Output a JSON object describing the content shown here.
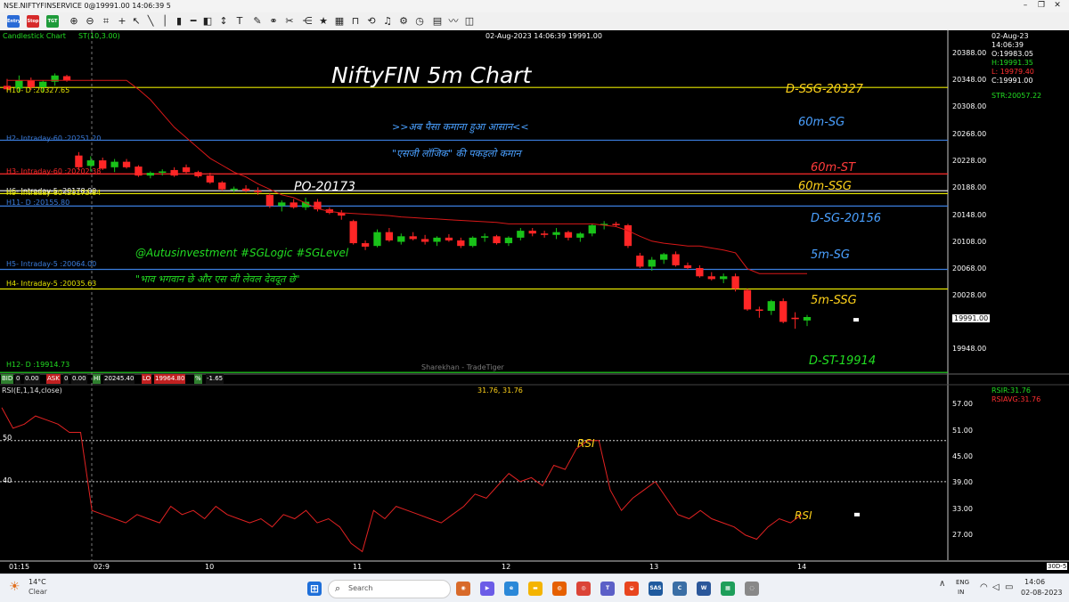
{
  "window": {
    "title": "NSE.NIFTYFINSERVICE 0@19991.00 14:06:39 5"
  },
  "toolbar": {
    "entry_label": "Entry",
    "stop_label": "Stop",
    "tgt_label": "TGT"
  },
  "chart": {
    "type_label": "Candlestick Chart",
    "indicator_label": "ST(10,3.00)",
    "header_center": "02-Aug-2023 14:06:39 19991.00",
    "title": "NiftyFIN 5m Chart",
    "watermark": "Sharekhan - TradeTiger",
    "price_box": "19991.00",
    "info": {
      "date": "02-Aug-23",
      "time": "14:06:39",
      "open": "O:19983.05",
      "high": "H:19991.35",
      "low": "L: 19979.40",
      "close": "C:19991.00",
      "str": "STR:20057.22"
    },
    "price_ticks": [
      "20388.00",
      "20348.00",
      "20308.00",
      "20268.00",
      "20228.00",
      "20188.00",
      "20148.00",
      "20108.00",
      "20068.00",
      "20028.00",
      "19948.00"
    ],
    "levels": [
      {
        "label": "H10- D :20327.65",
        "color": "#e6e600"
      },
      {
        "label": "H2- Intraday-60 :20251.20",
        "color": "#3b7ddd"
      },
      {
        "label": "H3- Intraday-60 :20202.38",
        "color": "#ff2b2b"
      },
      {
        "label": "H6- Intraday-5 :20178.00",
        "color": "#ffffff"
      },
      {
        "label": "H9- Intraday-60 :20173.84",
        "color": "#e6e600"
      },
      {
        "label": "H11- D :20155.80",
        "color": "#3b7ddd"
      },
      {
        "label": "H5- Intraday-5 :20064.00",
        "color": "#3b7ddd"
      },
      {
        "label": "H4- Intraday-5 :20035.63",
        "color": "#e6e600"
      },
      {
        "label": "H12- D :19914.73",
        "color": "#22dd22"
      }
    ],
    "annotations": {
      "dssg": "D-SSG-20327",
      "sg60": "60m-SG",
      "st60": "60m-ST",
      "ssg60": "60m-SSG",
      "dsg": "D-SG-20156",
      "sg5": "5m-SG",
      "ssg5": "5m-SSG",
      "dst": "D-ST-19914",
      "po": "PO-20173",
      "hindi1": ">>अब पैसा कमाना हुआ आसान<<",
      "hindi2": "\"एसजी लॉजिक\" की पकड़लो कमान",
      "tags": "@Autusinvestment  #SGLogic  #SGLevel",
      "hindi3": "\"भाव भगवान छे और एस जी लेवल देवदूत छे\"",
      "rsi1": "RSI",
      "rsi2": "RSI"
    },
    "bidbar": {
      "bid_label": "BID",
      "bid_qty": "0",
      "bid_val": "0.00",
      "ask_label": "ASK",
      "ask_qty": "0",
      "ask_val": "0.00",
      "hi_label": "HI",
      "hi_val": "20245.40",
      "lo_label": "LO",
      "lo_val": "19964.80",
      "pct_label": "%",
      "pct_val": "-1.65"
    },
    "rsi": {
      "label": "RSI(E,1,14,close)",
      "value_text": "31.76, 31.76",
      "rsir": "RSIR:31.76",
      "rsiavg": "RSIAVG:31.76",
      "ticks": [
        "57.00",
        "51.00",
        "45.00",
        "39.00",
        "33.00",
        "27.00"
      ],
      "left_ticks": [
        "50",
        "40"
      ]
    },
    "time_ticks": [
      "01:15",
      "02:9",
      "10",
      "11",
      "12",
      "13",
      "14"
    ],
    "corner_label": "30D-5"
  },
  "chart_data": {
    "type": "candlestick",
    "title": "NiftyFIN 5m Chart",
    "ylim": [
      19915,
      20395
    ],
    "candles": [
      {
        "o": 20330,
        "h": 20340,
        "l": 20322,
        "c": 20325
      },
      {
        "o": 20326,
        "h": 20345,
        "l": 20320,
        "c": 20338
      },
      {
        "o": 20338,
        "h": 20342,
        "l": 20324,
        "c": 20328
      },
      {
        "o": 20328,
        "h": 20338,
        "l": 20320,
        "c": 20336
      },
      {
        "o": 20336,
        "h": 20348,
        "l": 20330,
        "c": 20345
      },
      {
        "o": 20344,
        "h": 20346,
        "l": 20336,
        "c": 20338
      },
      {
        "o": 20229,
        "h": 20234,
        "l": 20208,
        "c": 20212
      },
      {
        "o": 20214,
        "h": 20228,
        "l": 20206,
        "c": 20222
      },
      {
        "o": 20222,
        "h": 20226,
        "l": 20208,
        "c": 20210
      },
      {
        "o": 20212,
        "h": 20224,
        "l": 20205,
        "c": 20220
      },
      {
        "o": 20220,
        "h": 20224,
        "l": 20210,
        "c": 20212
      },
      {
        "o": 20213,
        "h": 20215,
        "l": 20198,
        "c": 20200
      },
      {
        "o": 20200,
        "h": 20206,
        "l": 20196,
        "c": 20204
      },
      {
        "o": 20204,
        "h": 20209,
        "l": 20200,
        "c": 20206
      },
      {
        "o": 20208,
        "h": 20212,
        "l": 20198,
        "c": 20200
      },
      {
        "o": 20212,
        "h": 20216,
        "l": 20203,
        "c": 20205
      },
      {
        "o": 20205,
        "h": 20207,
        "l": 20197,
        "c": 20199
      },
      {
        "o": 20200,
        "h": 20204,
        "l": 20188,
        "c": 20190
      },
      {
        "o": 20190,
        "h": 20192,
        "l": 20178,
        "c": 20180
      },
      {
        "o": 20180,
        "h": 20184,
        "l": 20176,
        "c": 20181
      },
      {
        "o": 20181,
        "h": 20186,
        "l": 20176,
        "c": 20178
      },
      {
        "o": 20178,
        "h": 20183,
        "l": 20172,
        "c": 20176
      },
      {
        "o": 20172,
        "h": 20174,
        "l": 20153,
        "c": 20156
      },
      {
        "o": 20156,
        "h": 20164,
        "l": 20148,
        "c": 20161
      },
      {
        "o": 20161,
        "h": 20166,
        "l": 20152,
        "c": 20154
      },
      {
        "o": 20154,
        "h": 20168,
        "l": 20150,
        "c": 20162
      },
      {
        "o": 20162,
        "h": 20166,
        "l": 20148,
        "c": 20151
      },
      {
        "o": 20151,
        "h": 20154,
        "l": 20144,
        "c": 20146
      },
      {
        "o": 20146,
        "h": 20150,
        "l": 20136,
        "c": 20142
      },
      {
        "o": 20134,
        "h": 20136,
        "l": 20100,
        "c": 20102
      },
      {
        "o": 20102,
        "h": 20106,
        "l": 20092,
        "c": 20097
      },
      {
        "o": 20098,
        "h": 20122,
        "l": 20096,
        "c": 20118
      },
      {
        "o": 20118,
        "h": 20124,
        "l": 20104,
        "c": 20106
      },
      {
        "o": 20104,
        "h": 20116,
        "l": 20100,
        "c": 20112
      },
      {
        "o": 20112,
        "h": 20118,
        "l": 20106,
        "c": 20108
      },
      {
        "o": 20108,
        "h": 20114,
        "l": 20100,
        "c": 20104
      },
      {
        "o": 20104,
        "h": 20112,
        "l": 20098,
        "c": 20110
      },
      {
        "o": 20110,
        "h": 20115,
        "l": 20104,
        "c": 20106
      },
      {
        "o": 20106,
        "h": 20110,
        "l": 20095,
        "c": 20098
      },
      {
        "o": 20098,
        "h": 20112,
        "l": 20096,
        "c": 20110
      },
      {
        "o": 20110,
        "h": 20116,
        "l": 20104,
        "c": 20112
      },
      {
        "o": 20112,
        "h": 20114,
        "l": 20100,
        "c": 20102
      },
      {
        "o": 20102,
        "h": 20112,
        "l": 20098,
        "c": 20110
      },
      {
        "o": 20110,
        "h": 20124,
        "l": 20106,
        "c": 20120
      },
      {
        "o": 20120,
        "h": 20124,
        "l": 20112,
        "c": 20116
      },
      {
        "o": 20116,
        "h": 20120,
        "l": 20110,
        "c": 20114
      },
      {
        "o": 20114,
        "h": 20124,
        "l": 20108,
        "c": 20118
      },
      {
        "o": 20118,
        "h": 20120,
        "l": 20106,
        "c": 20110
      },
      {
        "o": 20110,
        "h": 20118,
        "l": 20104,
        "c": 20116
      },
      {
        "o": 20116,
        "h": 20130,
        "l": 20112,
        "c": 20128
      },
      {
        "o": 20128,
        "h": 20134,
        "l": 20122,
        "c": 20130
      },
      {
        "o": 20130,
        "h": 20133,
        "l": 20126,
        "c": 20128
      },
      {
        "o": 20128,
        "h": 20130,
        "l": 20095,
        "c": 20098
      },
      {
        "o": 20084,
        "h": 20088,
        "l": 20066,
        "c": 20068
      },
      {
        "o": 20068,
        "h": 20082,
        "l": 20062,
        "c": 20078
      },
      {
        "o": 20078,
        "h": 20088,
        "l": 20072,
        "c": 20086
      },
      {
        "o": 20086,
        "h": 20090,
        "l": 20068,
        "c": 20070
      },
      {
        "o": 20070,
        "h": 20074,
        "l": 20064,
        "c": 20066
      },
      {
        "o": 20066,
        "h": 20070,
        "l": 20052,
        "c": 20054
      },
      {
        "o": 20054,
        "h": 20060,
        "l": 20048,
        "c": 20050
      },
      {
        "o": 20050,
        "h": 20058,
        "l": 20044,
        "c": 20054
      },
      {
        "o": 20054,
        "h": 20058,
        "l": 20032,
        "c": 20036
      },
      {
        "o": 20034,
        "h": 20036,
        "l": 20004,
        "c": 20006
      },
      {
        "o": 20006,
        "h": 20010,
        "l": 19994,
        "c": 20004
      },
      {
        "o": 20004,
        "h": 20020,
        "l": 19998,
        "c": 20018
      },
      {
        "o": 20018,
        "h": 20022,
        "l": 19986,
        "c": 19988
      },
      {
        "o": 19994,
        "h": 20002,
        "l": 19978,
        "c": 19992
      },
      {
        "o": 19990,
        "h": 19998,
        "l": 19982,
        "c": 19995
      }
    ],
    "supertrend": [
      20338,
      20338,
      20338,
      20338,
      20338,
      20338,
      20338,
      20338,
      20338,
      20338,
      20338,
      20325,
      20310,
      20290,
      20270,
      20255,
      20240,
      20225,
      20215,
      20205,
      20198,
      20188,
      20180,
      20172,
      20168,
      20160,
      20152,
      20148,
      20146,
      20145,
      20144,
      20143,
      20142,
      20140,
      20139,
      20138,
      20137,
      20136,
      20135,
      20134,
      20133,
      20132,
      20130,
      20130,
      20130,
      20130,
      20130,
      20130,
      20130,
      20130,
      20128,
      20126,
      20120,
      20112,
      20105,
      20102,
      20100,
      20098,
      20098,
      20095,
      20092,
      20088,
      20065,
      20058,
      20058,
      20058,
      20058,
      20058
    ],
    "levels": [
      20327.65,
      20251.2,
      20202.38,
      20178.0,
      20173.84,
      20155.8,
      20064.0,
      20035.63,
      19914.73
    ],
    "rsi_ylim": [
      22,
      61
    ],
    "rsi_series": [
      58,
      53,
      54,
      56,
      55,
      54,
      52,
      52,
      33,
      32,
      31,
      30,
      32,
      31,
      30,
      34,
      32,
      33,
      31,
      34,
      32,
      31,
      30,
      31,
      29,
      32,
      31,
      33,
      30,
      31,
      29,
      25,
      23,
      33,
      31,
      34,
      33,
      32,
      31,
      30,
      32,
      34,
      37,
      36,
      39,
      42,
      40,
      41,
      39,
      44,
      43,
      48,
      50,
      50,
      38,
      33,
      36,
      38,
      40,
      36,
      32,
      31,
      33,
      31,
      30,
      29,
      27,
      26,
      29,
      31,
      30,
      32
    ],
    "rsi_levels": [
      50,
      40
    ],
    "time_ticks": [
      "01:15",
      "02:9",
      "10",
      "11",
      "12",
      "13",
      "14"
    ]
  }
}
